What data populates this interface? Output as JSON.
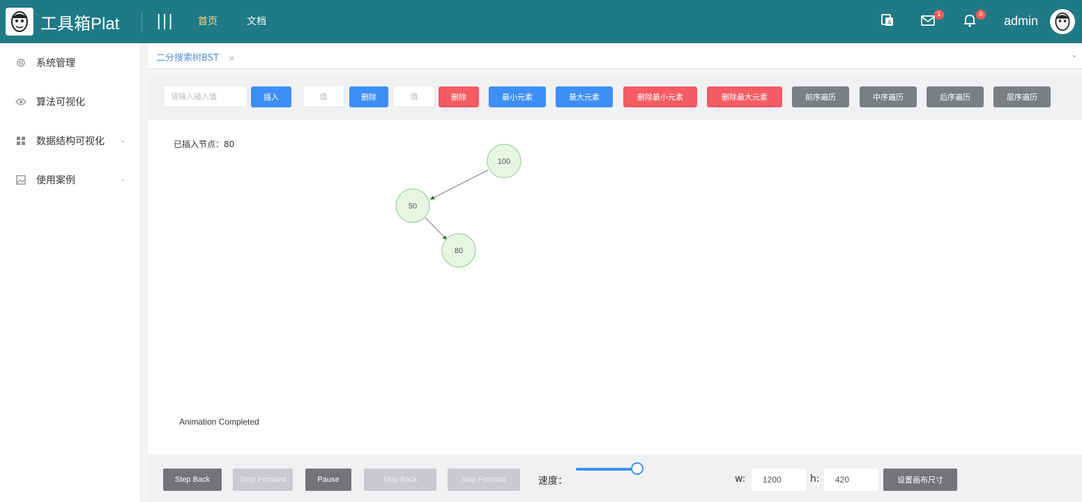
{
  "header": {
    "brand": "工具箱Plat",
    "hamburger": "|||",
    "nav": [
      {
        "label": "首页",
        "active": true
      },
      {
        "label": "文档",
        "active": false
      }
    ],
    "icons": [
      "translate-icon",
      "mail-icon",
      "bell-icon"
    ],
    "badges": {
      "mail": "1",
      "bell": "0"
    },
    "user": "admin"
  },
  "sidebar": {
    "items": [
      {
        "label": "系统管理",
        "icon": "settings-icon",
        "expandable": false
      },
      {
        "label": "算法可视化",
        "icon": "eye-icon",
        "expandable": false
      },
      {
        "label": "数据结构可视化",
        "icon": "grid-icon",
        "expandable": true
      },
      {
        "label": "使用案例",
        "icon": "image-icon",
        "expandable": true
      }
    ]
  },
  "tabs": {
    "active": "二分搜索树BST",
    "close": "×"
  },
  "toolbar": {
    "input_placeholder": "请输入插入值",
    "insert": "插入",
    "input2_placeholder": "值",
    "delete_btn": "删除",
    "input3_placeholder": "值",
    "remove_btn": "删除",
    "min_element": "最小元素",
    "max_element": "最大元素",
    "remove_min": "删除最小元素",
    "remove_max": "删除最大元素",
    "preorder": "前序遍历",
    "inorder": "中序遍历",
    "postorder": "后序遍历",
    "levelorder": "层序遍历"
  },
  "canvas": {
    "status": "已插入节点：80",
    "animation_message": "Animation Completed",
    "nodes": [
      {
        "value": "100",
        "parent": null
      },
      {
        "value": "50",
        "parent": "100"
      },
      {
        "value": "80",
        "parent": "50"
      }
    ]
  },
  "bottom": {
    "step_back": "Step Back",
    "step_forward": "Step Forward",
    "pause": "Pause",
    "skip_back": "Skip Back",
    "skip_forward": "Skip Forward",
    "speed_label": "速度：",
    "speed_fraction": 0.85,
    "width_label": "w:",
    "width_value": "1200",
    "height_label": "h:",
    "height_value": "420",
    "set_canvas": "设置画布尺寸"
  },
  "colors": {
    "header": "#1f7a86",
    "active_nav": "#ffd27f",
    "blue_button": "#3d8ff5",
    "red_button": "#f55b63",
    "gray_button": "#7b7e84",
    "node_fill": "#e6f6e3",
    "node_stroke": "#8fc98a"
  }
}
